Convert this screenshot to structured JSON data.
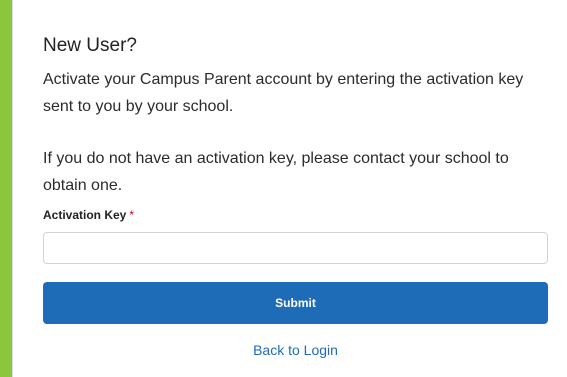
{
  "card": {
    "title": "New User?",
    "paragraph1": "Activate your Campus Parent account by entering the activation key sent to you by your school.",
    "paragraph2": "If you do not have an activation key, please contact your school to obtain one."
  },
  "form": {
    "activation_key_label": "Activation Key",
    "required_marker": "*",
    "activation_key_value": "",
    "submit_label": "Submit",
    "back_link": "Back to Login"
  },
  "colors": {
    "page_background": "#8cc63f",
    "primary_button": "#1e6bb8",
    "link": "#1e6bb8",
    "required": "#d0021b"
  }
}
